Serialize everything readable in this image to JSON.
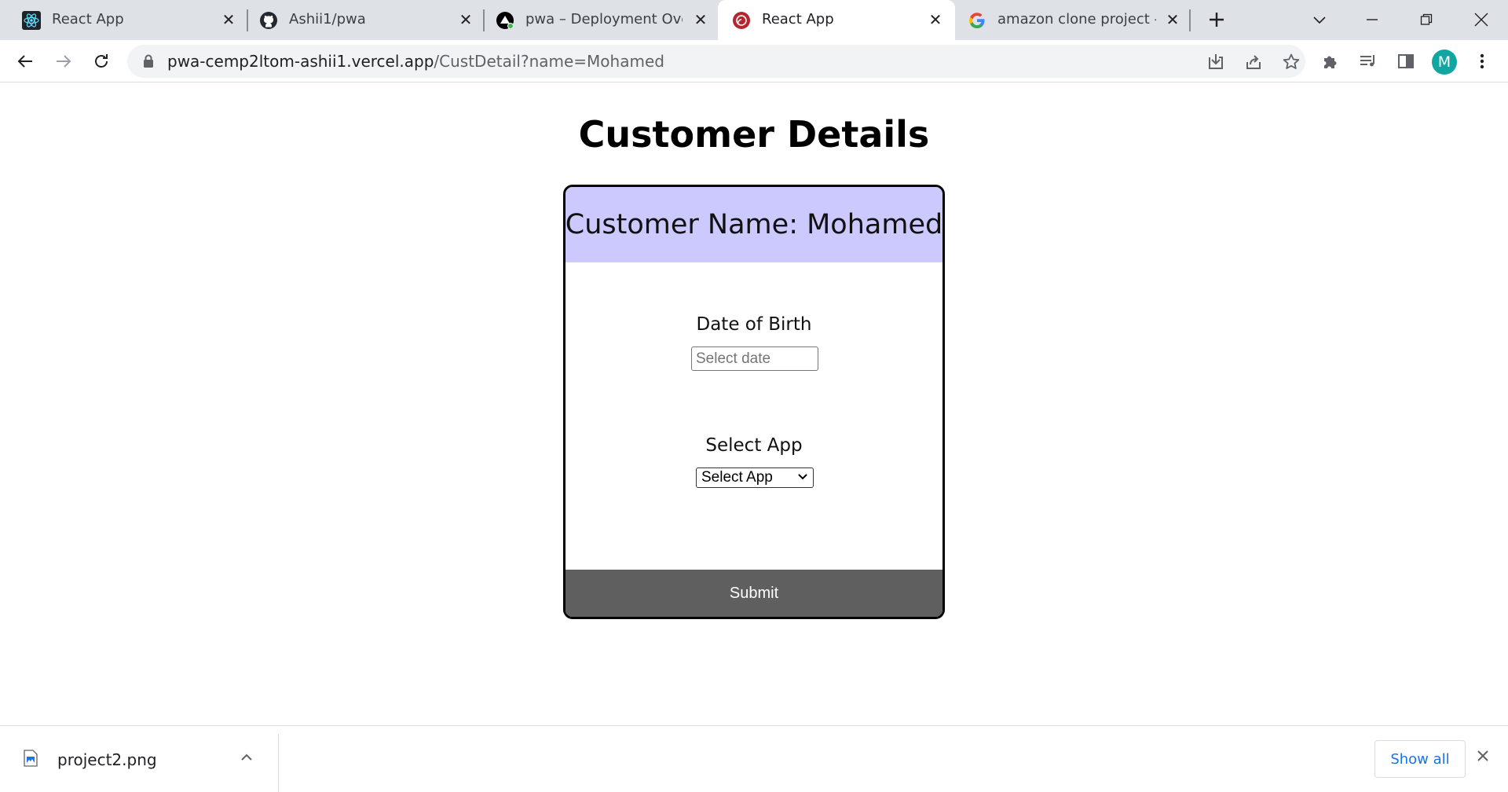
{
  "browser": {
    "tabs": [
      {
        "title": "React App",
        "icon": "react-icon",
        "active": false
      },
      {
        "title": "Ashii1/pwa",
        "icon": "github-icon",
        "active": false
      },
      {
        "title": "pwa – Deployment Overv",
        "icon": "vercel-icon",
        "active": false
      },
      {
        "title": "React App",
        "icon": "redux-icon",
        "active": true
      },
      {
        "title": "amazon clone project - G",
        "icon": "google-icon",
        "active": false
      }
    ],
    "url_host": "pwa-cemp2ltom-ashii1.vercel.app",
    "url_path": "/CustDetail?name=Mohamed",
    "profile_initial": "M",
    "profile_color": "#12a6a3"
  },
  "page": {
    "title": "Customer Details",
    "customer_name_label": "Customer Name: Mohamed",
    "dob_label": "Date of Birth",
    "dob_placeholder": "Select date",
    "app_label": "Select App",
    "app_selected": "Select App",
    "submit_label": "Submit",
    "header_color": "#ccc9ff",
    "submit_color": "#5f5f5f"
  },
  "downloads": {
    "file_name": "project2.png",
    "show_all_label": "Show all"
  }
}
